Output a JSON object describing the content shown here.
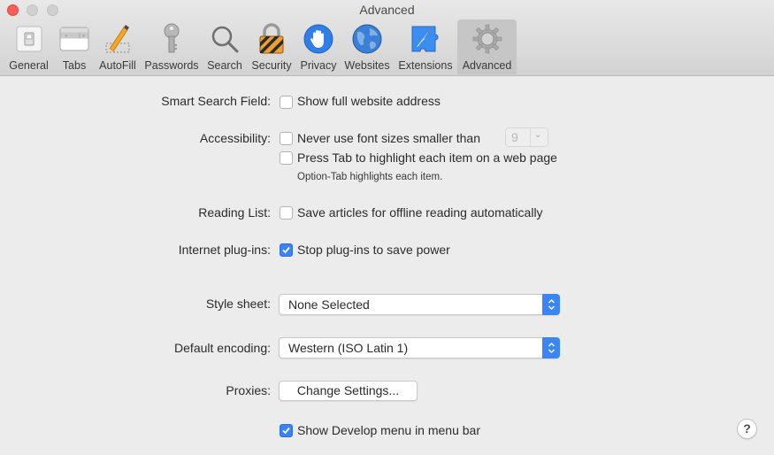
{
  "window": {
    "title": "Advanced"
  },
  "toolbar": {
    "items": [
      {
        "label": "General",
        "icon": "general-switch-icon"
      },
      {
        "label": "Tabs",
        "icon": "tabs-icon"
      },
      {
        "label": "AutoFill",
        "icon": "pencil-icon"
      },
      {
        "label": "Passwords",
        "icon": "key-icon"
      },
      {
        "label": "Search",
        "icon": "magnifier-icon"
      },
      {
        "label": "Security",
        "icon": "padlock-icon"
      },
      {
        "label": "Privacy",
        "icon": "hand-icon"
      },
      {
        "label": "Websites",
        "icon": "globe-icon"
      },
      {
        "label": "Extensions",
        "icon": "puzzle-compass-icon"
      },
      {
        "label": "Advanced",
        "icon": "gear-icon",
        "active": true
      }
    ]
  },
  "settings": {
    "smart_search": {
      "label": "Smart Search Field:",
      "option": "Show full website address",
      "checked": false
    },
    "accessibility": {
      "label": "Accessibility:",
      "min_font": {
        "option": "Never use font sizes smaller than",
        "checked": false,
        "value": "9"
      },
      "tab_highlight": {
        "option": "Press Tab to highlight each item on a web page",
        "checked": false,
        "hint": "Option-Tab highlights each item."
      }
    },
    "reading_list": {
      "label": "Reading List:",
      "option": "Save articles for offline reading automatically",
      "checked": false
    },
    "plugins": {
      "label": "Internet plug-ins:",
      "option": "Stop plug-ins to save power",
      "checked": true
    },
    "style_sheet": {
      "label": "Style sheet:",
      "value": "None Selected"
    },
    "encoding": {
      "label": "Default encoding:",
      "value": "Western (ISO Latin 1)"
    },
    "proxies": {
      "label": "Proxies:",
      "button": "Change Settings..."
    },
    "develop_menu": {
      "option": "Show Develop menu in menu bar",
      "checked": true
    }
  },
  "help": {
    "label": "?"
  },
  "colors": {
    "accent": "#3a86f5",
    "close": "#fc5f57"
  }
}
